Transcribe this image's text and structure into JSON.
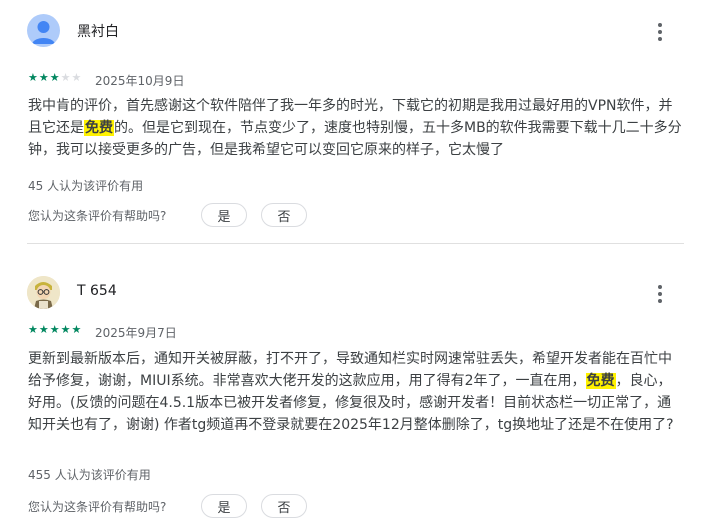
{
  "colors": {
    "star": "#01875f",
    "highlight": "#fff200",
    "avatar_bg": "#aecbfa"
  },
  "reviews": [
    {
      "author": "黑衬白",
      "avatar_icon": "person-icon",
      "rating": 3,
      "date": "2025年10月9日",
      "text_before": "我中肯的评价，首先感谢这个软件陪伴了我一年多的时光，下载它的初期是我用过最好用的VPN软件，并且它还是",
      "highlight": "免费",
      "text_after": "的。但是它到现在，节点变少了，速度也特别慢，五十多MB的软件我需要下载十几二十多分钟，我可以接受更多的广告，但是我希望它可以变回它原来的样子，它太慢了",
      "helpful_count": "45 人认为该评价有用",
      "helpful_question": "您认为这条评价有帮助吗?",
      "yes_label": "是",
      "no_label": "否"
    },
    {
      "author": "T 654",
      "avatar_icon": "cartoon-avatar-icon",
      "rating": 5,
      "date": "2025年9月7日",
      "text_before": "更新到最新版本后，通知开关被屏蔽，打不开了，导致通知栏实时网速常驻丢失，希望开发者能在百忙中给予修复，谢谢，MIUI系统。非常喜欢大佬开发的这款应用，用了得有2年了，一直在用，",
      "highlight": "免费",
      "text_after": "，良心，好用。(反馈的问题在4.5.1版本已被开发者修复，修复很及时，感谢开发者！目前状态栏一切正常了，通知开关也有了，谢谢) 作者tg频道再不登录就要在2025年12月整体删除了，tg换地址了还是不在使用了?",
      "helpful_count": "455 人认为该评价有用",
      "helpful_question": "您认为这条评价有帮助吗?",
      "yes_label": "是",
      "no_label": "否"
    }
  ]
}
